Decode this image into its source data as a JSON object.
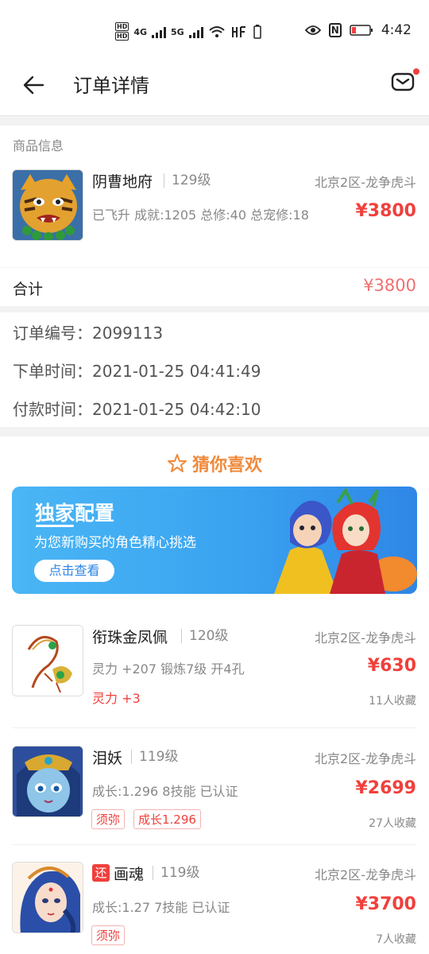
{
  "status_bar": {
    "hd1": "HD",
    "hd2": "HD",
    "net1": "4G",
    "net2": "5G",
    "hf": "N",
    "time": "4:42"
  },
  "header": {
    "title": "订单详情"
  },
  "product_section": {
    "label": "商品信息",
    "item": {
      "name": "阴曹地府",
      "level": "129级",
      "server": "北京2区-龙争虎斗",
      "desc": "已飞升 成就:1205 总修:40 总宠修:18",
      "price": "¥3800"
    }
  },
  "total": {
    "label": "合计",
    "value": "¥3800"
  },
  "order_info": {
    "number_label": "订单编号：",
    "number": "2099113",
    "created_label": "下单时间：",
    "created": "2021-01-25 04:41:49",
    "paid_label": "付款时间：",
    "paid": "2021-01-25 04:42:10"
  },
  "recommend": {
    "title": "猜你喜欢",
    "banner": {
      "title": "独家配置",
      "subtitle": "为您新购买的角色精心挑选",
      "button": "点击查看"
    },
    "items": [
      {
        "name": "衔珠金凤佩",
        "level": "120级",
        "server": "北京2区-龙争虎斗",
        "desc": "灵力 +207 锻炼7级 开4孔",
        "extra": "灵力 +3",
        "price": "¥630",
        "favorites": "11人收藏"
      },
      {
        "name": "泪妖",
        "level": "119级",
        "server": "北京2区-龙争虎斗",
        "desc": "成长:1.296 8技能 已认证",
        "tags": [
          "须弥",
          "成长1.296"
        ],
        "price": "¥2699",
        "favorites": "27人收藏"
      },
      {
        "badge": "还",
        "name": "画魂",
        "level": "119级",
        "server": "北京2区-龙争虎斗",
        "desc": "成长:1.27 7技能 已认证",
        "tags": [
          "须弥"
        ],
        "price": "¥3700",
        "favorites": "7人收藏"
      }
    ]
  },
  "colors": {
    "price_red": "#f0403c",
    "total_red": "#f07070",
    "title_orange": "#f08a3c",
    "banner_blue": "#3aa3f0"
  }
}
